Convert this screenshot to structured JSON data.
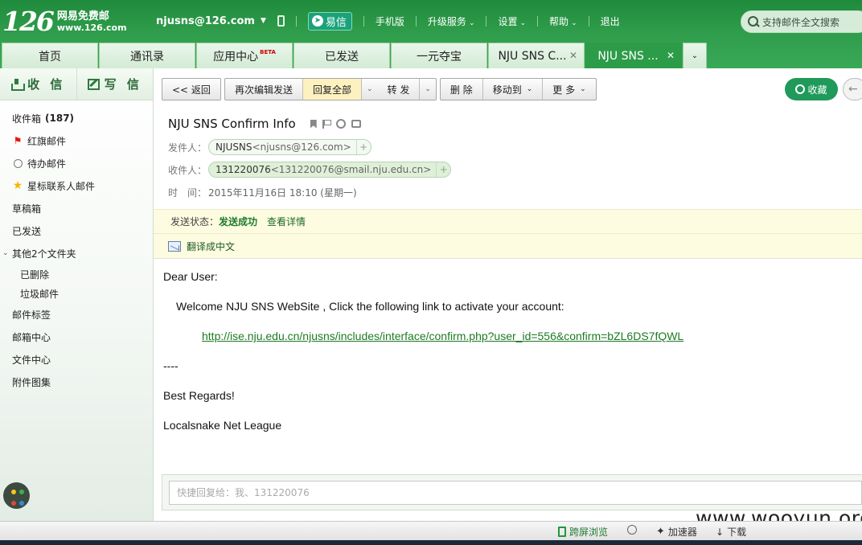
{
  "header": {
    "logo_num": "126",
    "logo_cn": "网易免费邮",
    "logo_url": "www.126.com",
    "account": "njusns@126.com",
    "yixin": "易信",
    "nav": [
      "手机版",
      "升级服务",
      "设置",
      "帮助",
      "退出"
    ],
    "search_placeholder": "支持邮件全文搜索"
  },
  "tabs": [
    {
      "label": "首页"
    },
    {
      "label": "通讯录"
    },
    {
      "label": "应用中心",
      "badge": "BETA"
    },
    {
      "label": "已发送"
    },
    {
      "label": "一元夺宝"
    },
    {
      "label": "NJU SNS C..."
    },
    {
      "label": "NJU SNS ..."
    }
  ],
  "sidebar": {
    "receive": "收 信",
    "write": "写 信",
    "inbox_label": "收件箱",
    "inbox_count": "(187)",
    "flagged": "红旗邮件",
    "todo": "待办邮件",
    "starred": "星标联系人邮件",
    "drafts": "草稿箱",
    "sent": "已发送",
    "other_folders": "其他2个文件夹",
    "deleted": "已删除",
    "spam": "垃圾邮件",
    "tags": "邮件标签",
    "mailbox_center": "邮箱中心",
    "file_center": "文件中心",
    "attachments": "附件图集"
  },
  "toolbar": {
    "back": "<< 返回",
    "re_edit": "再次编辑发送",
    "reply_all": "回复全部",
    "forward": "转 发",
    "delete": "删 除",
    "move_to": "移动到",
    "more": "更 多",
    "favorite": "收藏"
  },
  "mail": {
    "subject": "NJU SNS Confirm Info",
    "from_label": "发件人：",
    "from_name": "NJUSNS",
    "from_addr": "<njusns@126.com>",
    "to_label": "收件人：",
    "to_name": "131220076",
    "to_addr": "<131220076@smail.nju.edu.cn>",
    "time_label": "时　间：",
    "time": "2015年11月16日 18:10 (星期一)",
    "status_label": "发送状态：",
    "status_value": "发送成功",
    "status_link": "查看详情",
    "translate": "翻译成中文",
    "body": {
      "greeting": "Dear User:",
      "line1": "Welcome NJU SNS WebSite , Click the following link to activate your account:",
      "link": "http://ise.nju.edu.cn/njusns/includes/interface/confirm.php?user_id=556&confirm=bZL6DS7fQWL",
      "sep": "----",
      "regards": "Best Regards!",
      "signature": "Localsnake Net League"
    },
    "reply_placeholder": "快捷回复给：我、131220076"
  },
  "browser_bar": {
    "cross_screen": "跨屏浏览",
    "accelerator": "加速器",
    "download": "下载"
  },
  "watermark": "www.wooyun.org"
}
